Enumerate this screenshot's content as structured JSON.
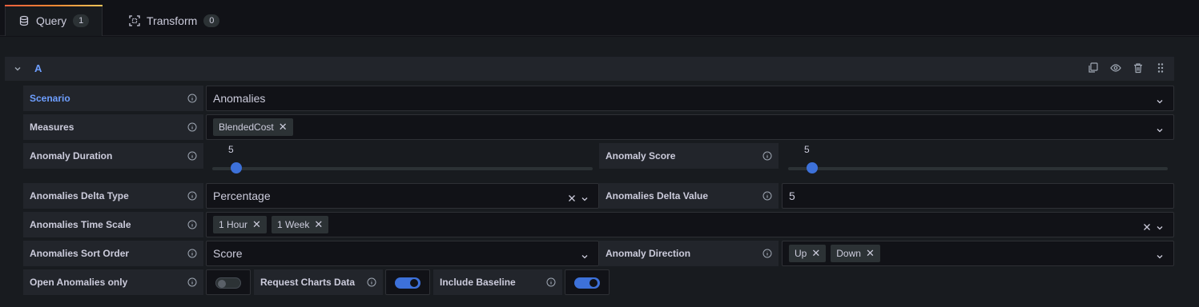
{
  "tabs": [
    {
      "label": "Query",
      "count": "1"
    },
    {
      "label": "Transform",
      "count": "0"
    }
  ],
  "query": {
    "ref_id": "A",
    "fields": {
      "scenario": {
        "label": "Scenario",
        "value": "Anomalies"
      },
      "measures": {
        "label": "Measures",
        "chips": [
          "BlendedCost"
        ]
      },
      "anomaly_duration": {
        "label": "Anomaly Duration",
        "value": "5",
        "fraction": 0.05
      },
      "anomaly_score": {
        "label": "Anomaly Score",
        "value": "5",
        "fraction": 0.05
      },
      "delta_type": {
        "label": "Anomalies Delta Type",
        "value": "Percentage"
      },
      "delta_value": {
        "label": "Anomalies Delta Value",
        "value": "5"
      },
      "time_scale": {
        "label": "Anomalies Time Scale",
        "chips": [
          "1 Hour",
          "1 Week"
        ]
      },
      "sort_order": {
        "label": "Anomalies Sort Order",
        "value": "Score"
      },
      "direction": {
        "label": "Anomaly Direction",
        "chips": [
          "Up",
          "Down"
        ]
      },
      "open_only": {
        "label": "Open Anomalies only",
        "on": false
      },
      "charts_data": {
        "label": "Request Charts Data",
        "on": true
      },
      "include_baseline": {
        "label": "Include Baseline",
        "on": true
      }
    }
  },
  "colors": {
    "accent": "#6e9fff",
    "switch_on": "#3d71d9"
  }
}
